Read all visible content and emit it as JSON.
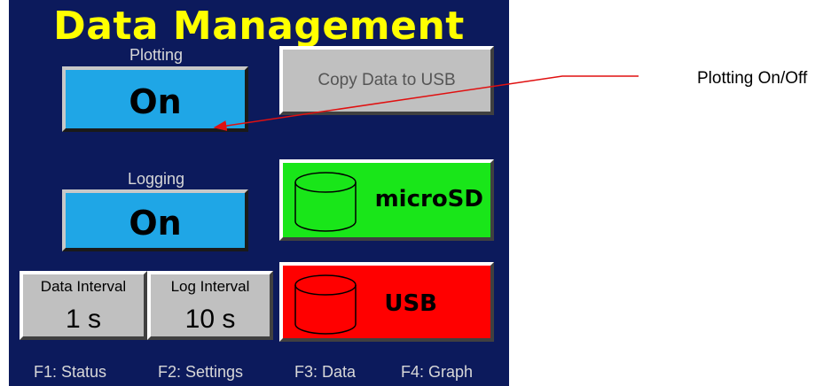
{
  "screen": {
    "title": "Data Management",
    "colors": {
      "background": "#0c1a5c",
      "title": "#ffff00",
      "on_button": "#1fa6e6",
      "microsd": "#19e619",
      "usb": "#ff0000",
      "gray_button": "#c0c0c0"
    }
  },
  "plotting": {
    "label": "Plotting",
    "value": "On"
  },
  "logging": {
    "label": "Logging",
    "value": "On"
  },
  "copy_button": {
    "label": "Copy Data to USB"
  },
  "microsd_button": {
    "label": "microSD",
    "icon": "drive-cylinder-icon"
  },
  "usb_button": {
    "label": "USB",
    "icon": "drive-cylinder-icon"
  },
  "data_interval": {
    "title": "Data Interval",
    "value": "1 s"
  },
  "log_interval": {
    "title": "Log Interval",
    "value": "10 s"
  },
  "function_keys": [
    "F1: Status",
    "F2: Settings",
    "F3: Data",
    "F4: Graph"
  ],
  "annotation": {
    "text": "Plotting On/Off",
    "arrow_color": "#e01010"
  }
}
